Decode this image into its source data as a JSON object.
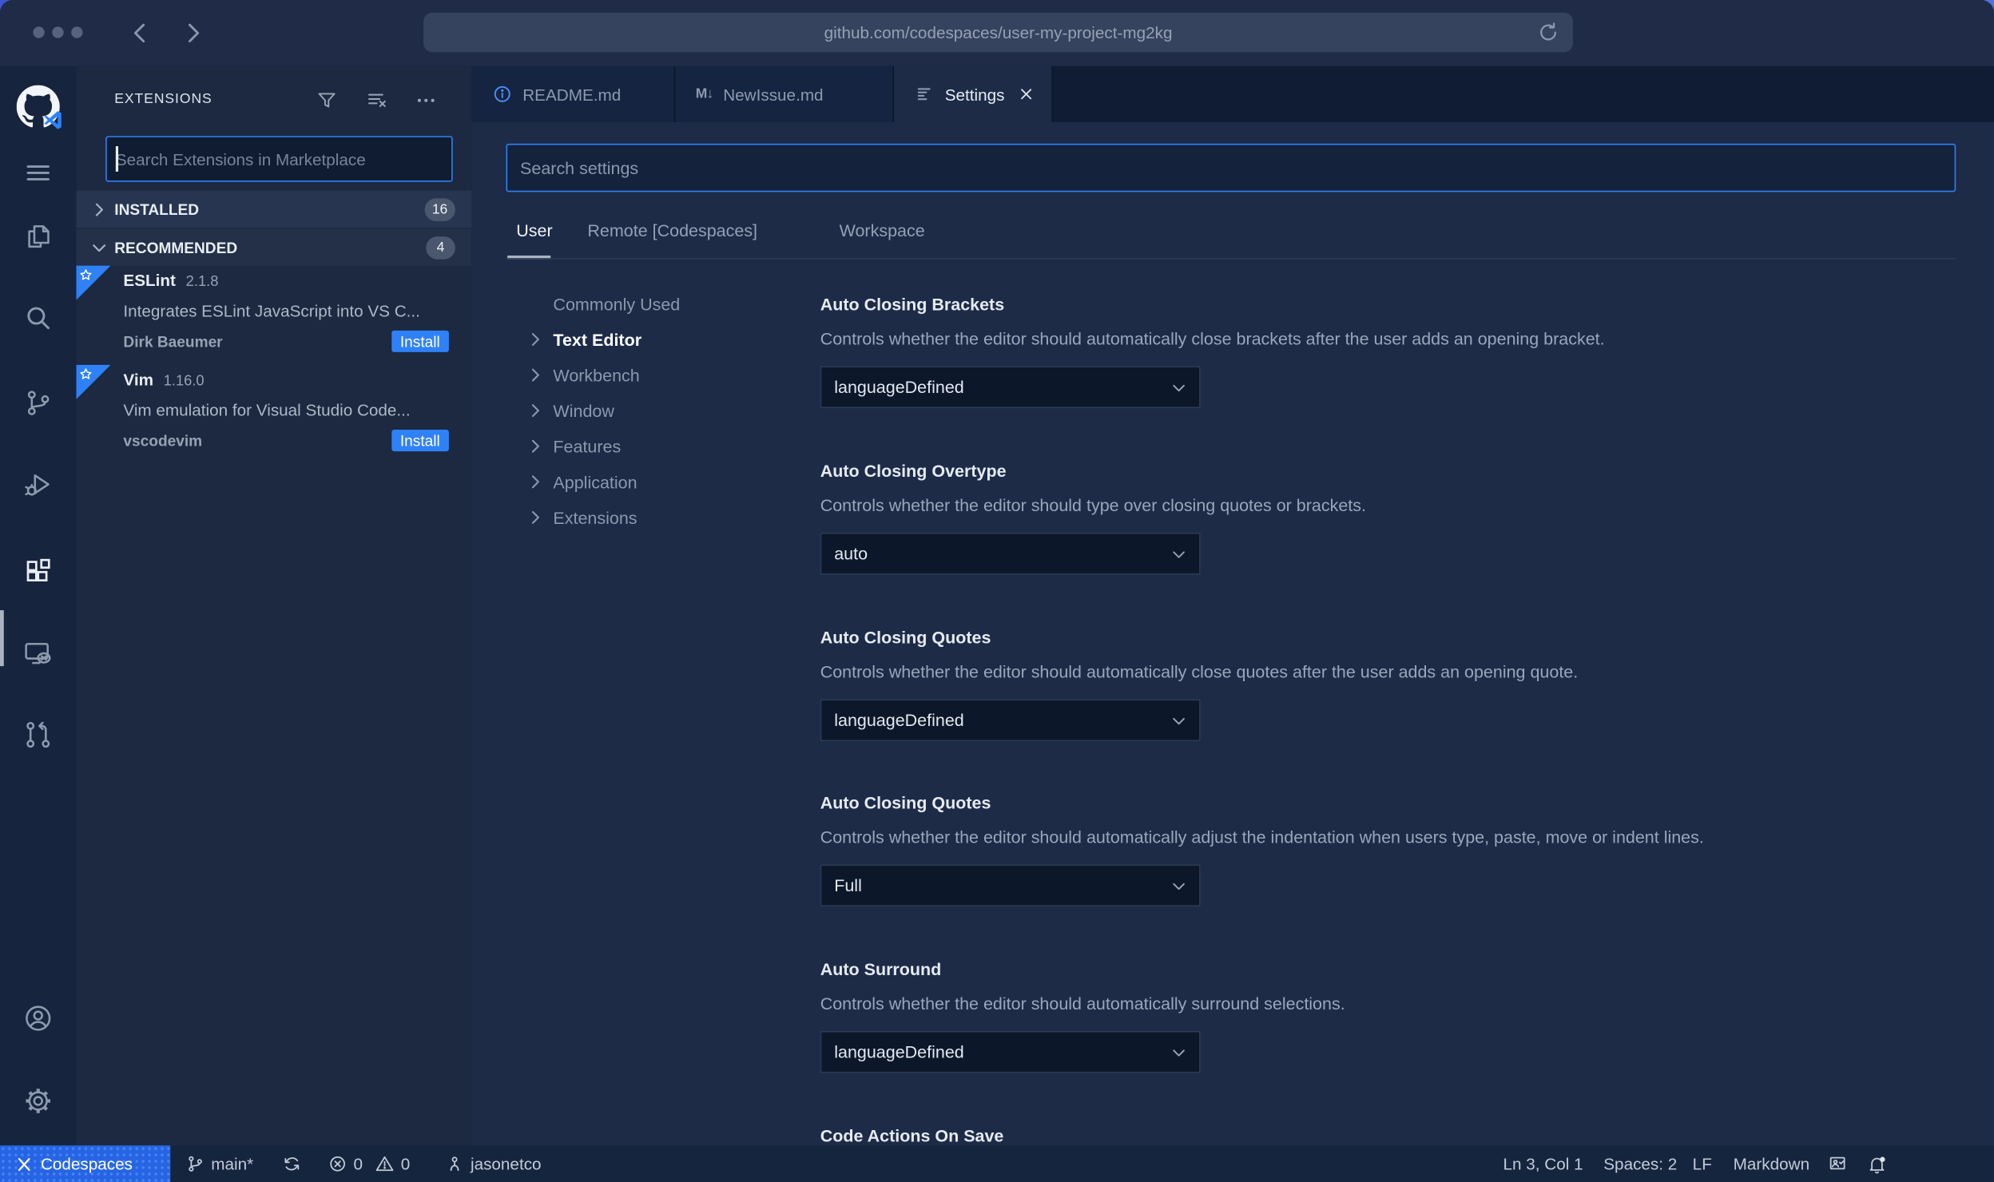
{
  "browser": {
    "url": "github.com/codespaces/user-my-project-mg2kg"
  },
  "sidebar": {
    "title": "EXTENSIONS",
    "search_placeholder": "Search Extensions in Marketplace",
    "sections": [
      {
        "label": "INSTALLED",
        "count": "16"
      },
      {
        "label": "RECOMMENDED",
        "count": "4"
      }
    ],
    "extensions": [
      {
        "name": "ESLint",
        "version": "2.1.8",
        "description": "Integrates ESLint JavaScript into VS C...",
        "author": "Dirk Baeumer",
        "action": "Install"
      },
      {
        "name": "Vim",
        "version": "1.16.0",
        "description": "Vim emulation for Visual Studio Code...",
        "author": "vscodevim",
        "action": "Install"
      }
    ]
  },
  "tabs": [
    {
      "label": "README.md"
    },
    {
      "label": "NewIssue.md",
      "icon_text": "M↓"
    },
    {
      "label": "Settings"
    }
  ],
  "settings": {
    "search_placeholder": "Search settings",
    "scope_tabs": [
      {
        "label": "User",
        "active": true
      },
      {
        "label": "Remote [Codespaces]",
        "active": false
      },
      {
        "label": "Workspace",
        "active": false
      }
    ],
    "toc": [
      {
        "label": "Commonly Used"
      },
      {
        "label": "Text Editor"
      },
      {
        "label": "Workbench"
      },
      {
        "label": "Window"
      },
      {
        "label": "Features"
      },
      {
        "label": "Application"
      },
      {
        "label": "Extensions"
      }
    ],
    "entries": [
      {
        "title": "Auto Closing Brackets",
        "description": "Controls whether the editor should automatically close brackets after the user adds an opening bracket.",
        "value": "languageDefined"
      },
      {
        "title": "Auto Closing Overtype",
        "description": "Controls whether the editor should type over closing quotes or brackets.",
        "value": "auto"
      },
      {
        "title": "Auto Closing Quotes",
        "description": "Controls whether the editor should automatically close quotes after the user adds an opening quote.",
        "value": "languageDefined"
      },
      {
        "title": "Auto Closing Quotes",
        "description": "Controls whether the editor should automatically adjust the indentation when users type, paste, move or indent lines.",
        "value": "Full"
      },
      {
        "title": "Auto Surround",
        "description": "Controls whether the editor should automatically surround selections.",
        "value": "languageDefined"
      },
      {
        "title": "Code Actions On Save",
        "description": "",
        "value": null
      }
    ]
  },
  "status_bar": {
    "codespaces": "Codespaces",
    "branch": "main*",
    "errors": "0",
    "warnings": "0",
    "user": "jasonetco",
    "cursor": "Ln 3, Col 1",
    "indent": "Spaces: 2",
    "eol": "LF",
    "language": "Markdown"
  },
  "colors": {
    "accent_blue": "#2f81f7",
    "codespaces_blue": "#2565e4",
    "editor_bg": "#1d2b47",
    "sidebar_bg": "#1c2941",
    "activitybar_bg": "#17243d",
    "statusbar_bg": "#16253e",
    "chrome_bg": "#202c47"
  }
}
